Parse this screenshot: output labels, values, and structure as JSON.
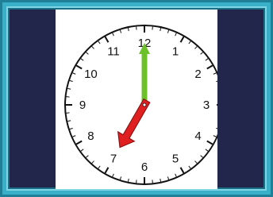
{
  "clock": {
    "numerals": [
      "12",
      "1",
      "2",
      "3",
      "4",
      "5",
      "6",
      "7",
      "8",
      "9",
      "10",
      "11"
    ],
    "time": {
      "hour": 7,
      "minute": 0
    },
    "hour_hand_color": "#e02020",
    "minute_hand_color": "#6cc02a"
  },
  "colors": {
    "frame": "#3ab0c8",
    "panel": "#23264b",
    "face": "#ffffff"
  }
}
